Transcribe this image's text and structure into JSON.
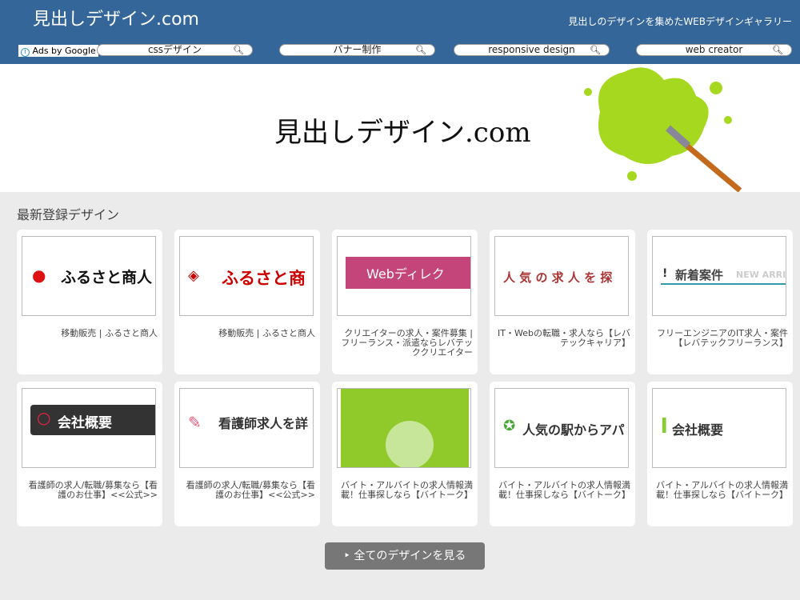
{
  "header": {
    "logo": "見出しデザイン.com",
    "tagline": "見出しのデザインを集めたWEBデザインギャラリー",
    "ads_label": "Ads by Google",
    "searches": [
      "cssデザイン",
      "バナー制作",
      "responsive design",
      "web creator"
    ]
  },
  "banner": {
    "title": "見出しデザイン.com"
  },
  "section_title": "最新登録デザイン",
  "cards": [
    {
      "thumb": "ふるさと商人",
      "caption": "移動販売 | ふるさと商人"
    },
    {
      "thumb": "ふるさと商",
      "caption": "移動販売 | ふるさと商人"
    },
    {
      "thumb": "Webディレク",
      "caption": "クリエイターの求人・案件募集 | フリーランス・派遣ならレバテッククリエイター"
    },
    {
      "thumb": "人 気 の 求 人 を 探",
      "caption": "IT・Webの転職・求人なら【レバテックキャリア】"
    },
    {
      "thumb": "新着案件",
      "thumb2": "NEW ARRI",
      "caption": "フリーエンジニアのIT求人・案件【レバテックフリーランス】"
    },
    {
      "thumb": "会社概要",
      "caption": "看護師の求人/転職/募集なら【看護のお仕事】<<公式>>"
    },
    {
      "thumb": "看護師求人を詳",
      "caption": "看護師の求人/転職/募集なら【看護のお仕事】<<公式>>"
    },
    {
      "thumb": "",
      "caption": "バイト・アルバイトの求人情報満載！仕事探しなら【バイトーク】"
    },
    {
      "thumb": "人気の駅からアパ",
      "caption": "バイト・アルバイトの求人情報満載！仕事探しなら【バイトーク】"
    },
    {
      "thumb": "会社概要",
      "caption": "バイト・アルバイトの求人情報満載！仕事探しなら【バイトーク】"
    }
  ],
  "view_all": "全てのデザインを見る"
}
